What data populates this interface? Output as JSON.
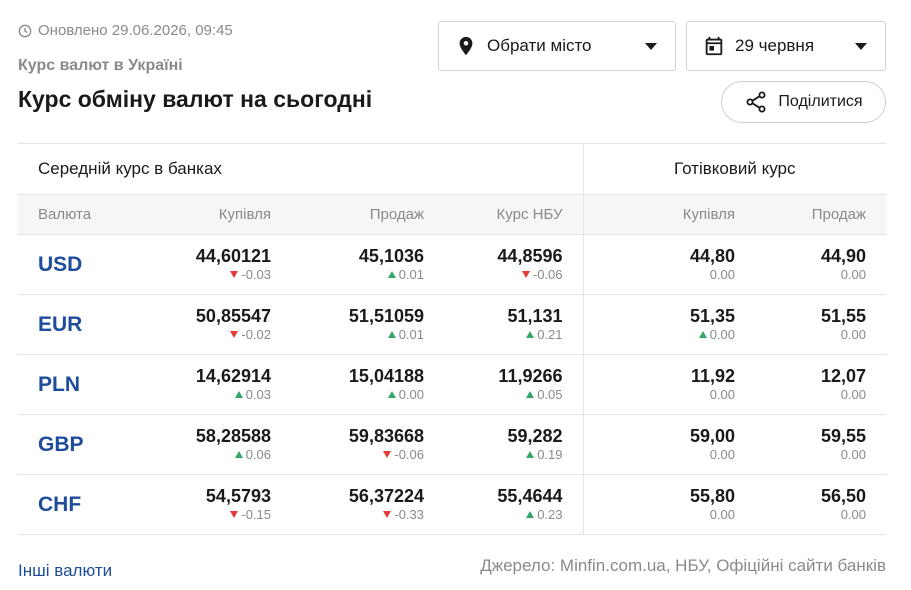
{
  "header": {
    "updated": "Оновлено 29.06.2026, 09:45",
    "subtitle": "Курс валют в Україні",
    "title": "Курс обміну валют на сьогодні"
  },
  "controls": {
    "city_label": "Обрати місто",
    "date_label": "29 червня",
    "share_label": "Поділитися"
  },
  "table": {
    "group_avg": "Середній курс в банках",
    "group_cash": "Готівковий курс",
    "columns": [
      "Валюта",
      "Купівля",
      "Продаж",
      "Курс НБУ",
      "Купівля",
      "Продаж"
    ],
    "rows": [
      {
        "code": "USD",
        "cells": [
          {
            "value": "44,60121",
            "change": "-0.03",
            "dir": "down"
          },
          {
            "value": "45,1036",
            "change": "0.01",
            "dir": "up"
          },
          {
            "value": "44,8596",
            "change": "-0.06",
            "dir": "down"
          },
          {
            "value": "44,80",
            "change": "0.00",
            "dir": "none"
          },
          {
            "value": "44,90",
            "change": "0.00",
            "dir": "none"
          }
        ]
      },
      {
        "code": "EUR",
        "cells": [
          {
            "value": "50,85547",
            "change": "-0.02",
            "dir": "down"
          },
          {
            "value": "51,51059",
            "change": "0.01",
            "dir": "up"
          },
          {
            "value": "51,131",
            "change": "0.21",
            "dir": "up"
          },
          {
            "value": "51,35",
            "change": "0.00",
            "dir": "up"
          },
          {
            "value": "51,55",
            "change": "0.00",
            "dir": "none"
          }
        ]
      },
      {
        "code": "PLN",
        "cells": [
          {
            "value": "14,62914",
            "change": "0.03",
            "dir": "up"
          },
          {
            "value": "15,04188",
            "change": "0.00",
            "dir": "up"
          },
          {
            "value": "11,9266",
            "change": "0.05",
            "dir": "up"
          },
          {
            "value": "11,92",
            "change": "0.00",
            "dir": "none"
          },
          {
            "value": "12,07",
            "change": "0.00",
            "dir": "none"
          }
        ]
      },
      {
        "code": "GBP",
        "cells": [
          {
            "value": "58,28588",
            "change": "0.06",
            "dir": "up"
          },
          {
            "value": "59,83668",
            "change": "-0.06",
            "dir": "down"
          },
          {
            "value": "59,282",
            "change": "0.19",
            "dir": "up"
          },
          {
            "value": "59,00",
            "change": "0.00",
            "dir": "none"
          },
          {
            "value": "59,55",
            "change": "0.00",
            "dir": "none"
          }
        ]
      },
      {
        "code": "CHF",
        "cells": [
          {
            "value": "54,5793",
            "change": "-0.15",
            "dir": "down"
          },
          {
            "value": "56,37224",
            "change": "-0.33",
            "dir": "down"
          },
          {
            "value": "55,4644",
            "change": "0.23",
            "dir": "up"
          },
          {
            "value": "55,80",
            "change": "0.00",
            "dir": "none"
          },
          {
            "value": "56,50",
            "change": "0.00",
            "dir": "none"
          }
        ]
      }
    ]
  },
  "footer": {
    "more_link": "Інші валюти",
    "source": "Джерело: Minfin.com.ua, НБУ, Офіційні сайти банків"
  },
  "colors": {
    "accent": "#1e4d9c",
    "up": "#35a56a",
    "down": "#e53935",
    "muted": "#8a8a8a"
  },
  "icons": [
    "clock-icon",
    "map-pin-icon",
    "calendar-icon",
    "chevron-down-icon",
    "share-icon",
    "arrow-up-icon",
    "arrow-down-icon"
  ]
}
